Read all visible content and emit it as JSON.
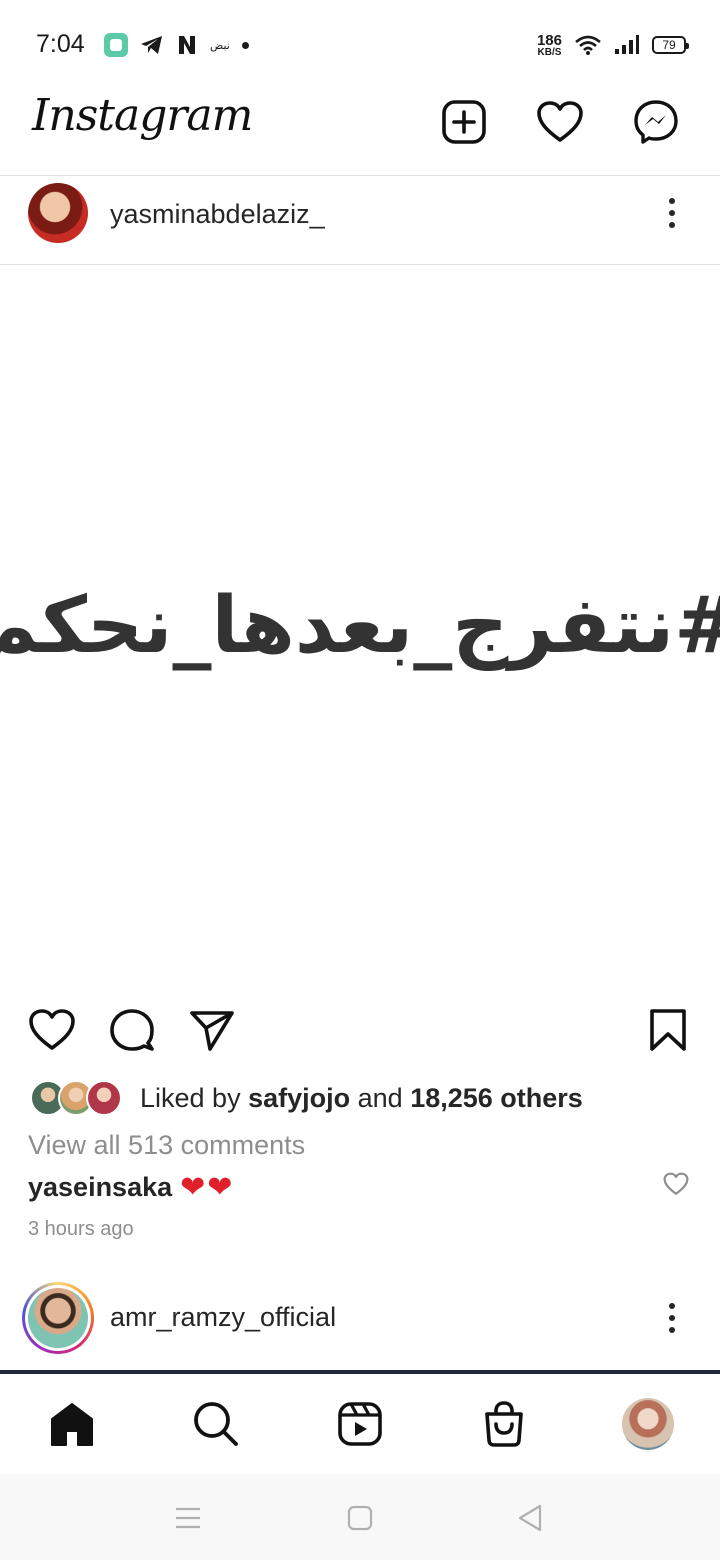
{
  "status_bar": {
    "time": "7:04",
    "notif_text": "نبض",
    "speed_value": "186",
    "speed_unit": "KB/S",
    "battery": "79"
  },
  "header": {
    "logo": "Instagram",
    "icons": [
      "add-post-icon",
      "heart-icon",
      "messenger-icon"
    ]
  },
  "post": {
    "username": "yasminabdelaziz_",
    "media_text": "#نتفرج_بعدها_نحكم",
    "likes_prefix": "Liked by",
    "liker": "safyjojo",
    "likes_and": "and",
    "likes_others": "18,256 others",
    "view_comments": "View all 513 comments",
    "comment_user": "yaseinsaka",
    "comment_text": "❤❤",
    "time_ago": "3 hours ago"
  },
  "next_post": {
    "username": "amr_ramzy_official"
  },
  "bottom_nav": [
    "home-icon",
    "search-icon",
    "reels-icon",
    "shop-icon",
    "profile-avatar"
  ],
  "colors": {
    "text": "#262626",
    "muted": "#8e8e8e",
    "heart_red": "#e0202b"
  }
}
